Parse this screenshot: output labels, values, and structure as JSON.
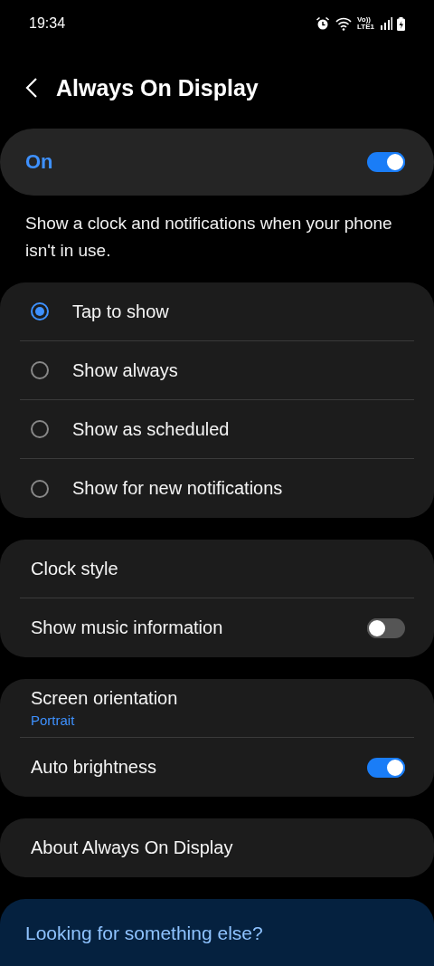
{
  "status_bar": {
    "time": "19:34",
    "network_label": [
      "Vo))",
      "LTE1"
    ]
  },
  "header": {
    "title": "Always On Display"
  },
  "master_switch": {
    "label": "On",
    "on": true
  },
  "description": "Show a clock and notifications when your phone isn't in use.",
  "sections": [
    {
      "items": [
        {
          "kind": "radio",
          "label": "Tap to show",
          "selected": true
        },
        {
          "kind": "radio",
          "label": "Show always",
          "selected": false
        },
        {
          "kind": "radio",
          "label": "Show as scheduled",
          "selected": false
        },
        {
          "kind": "radio",
          "label": "Show for new notifications",
          "selected": false
        }
      ]
    },
    {
      "items": [
        {
          "kind": "link",
          "label": "Clock style"
        },
        {
          "kind": "switch",
          "label": "Show music information",
          "on": false
        }
      ]
    },
    {
      "items": [
        {
          "kind": "link",
          "label": "Screen orientation",
          "summary": "Portrait"
        },
        {
          "kind": "switch",
          "label": "Auto brightness",
          "on": true
        }
      ]
    },
    {
      "items": [
        {
          "kind": "link",
          "label": "About Always On Display"
        }
      ]
    }
  ],
  "suggestion_card": {
    "title": "Looking for something else?"
  }
}
